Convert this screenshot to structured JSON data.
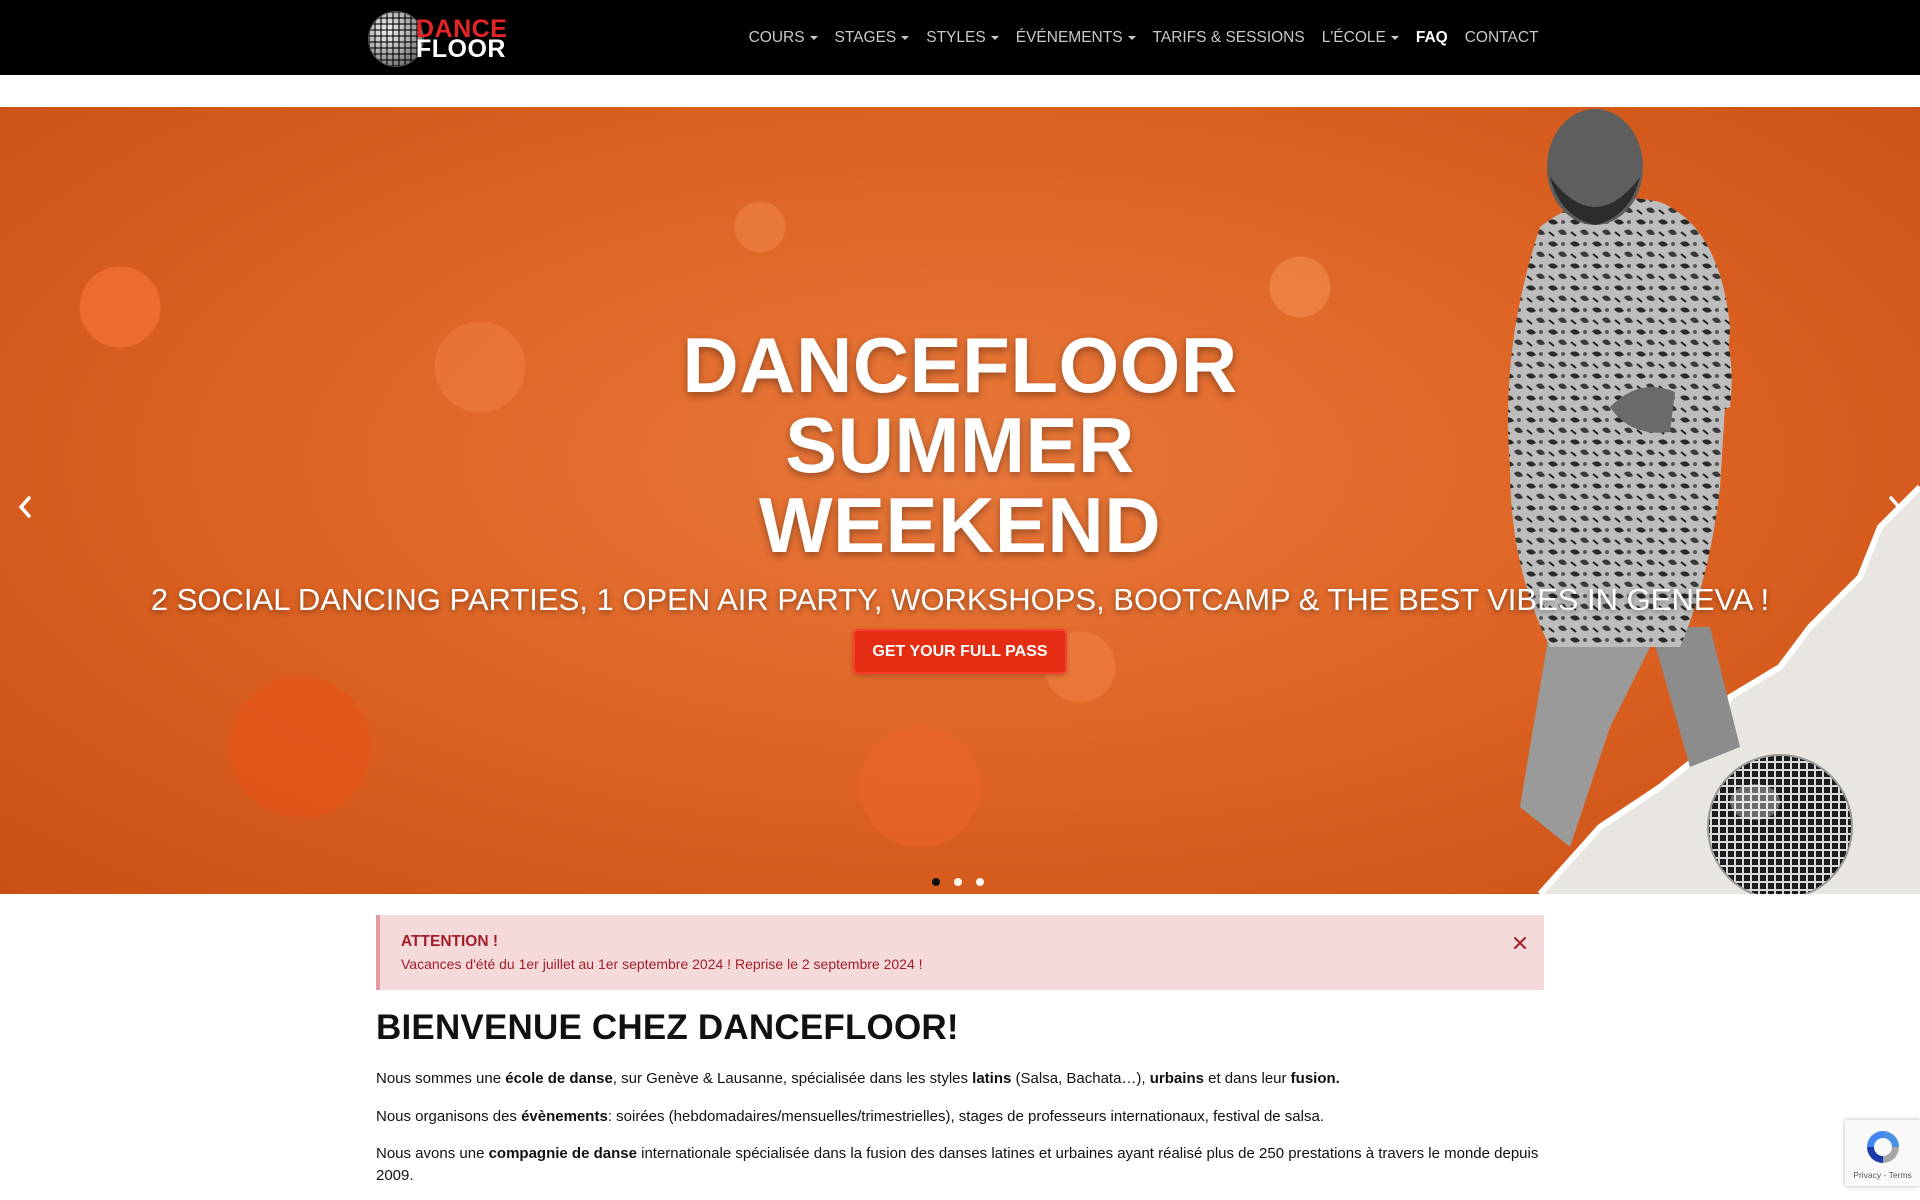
{
  "brand": {
    "line1": "DANCE",
    "line2": "FLOOR",
    "colors": {
      "red": "#e52426",
      "white": "#ffffff",
      "navbar": "#000000"
    }
  },
  "nav": {
    "items": [
      {
        "label": "COURS",
        "dropdown": true
      },
      {
        "label": "STAGES",
        "dropdown": true
      },
      {
        "label": "STYLES",
        "dropdown": true
      },
      {
        "label": "ÉVÉNEMENTS",
        "dropdown": true
      },
      {
        "label": "TARIFS & SESSIONS",
        "dropdown": false
      },
      {
        "label": "L'ÉCOLE",
        "dropdown": true
      },
      {
        "label": "FAQ",
        "dropdown": false,
        "active": true
      },
      {
        "label": "CONTACT",
        "dropdown": false
      }
    ]
  },
  "hero": {
    "title_line1": "DANCEFLOOR",
    "title_line2": "SUMMER",
    "title_line3": "WEEKEND",
    "subtitle": "2 SOCIAL DANCING PARTIES, 1 OPEN AIR PARTY, WORKSHOPS, BOOTCAMP & THE BEST VIBES IN GENEVA !",
    "button_label": "GET YOUR FULL PASS",
    "prev_icon": "chevron-left-icon",
    "next_icon": "chevron-right-icon",
    "slides_count": 3,
    "active_slide": 1,
    "background_color": "#dd6424",
    "button_color": "#e42d12"
  },
  "alert": {
    "title": "ATTENTION !",
    "text": "Vacances d'été du 1er juillet au 1er septembre 2024 ! Reprise le 2 septembre 2024 !",
    "close_icon": "close-icon",
    "color": "#a31e28",
    "background": "#f5dadc"
  },
  "content": {
    "heading": "BIENVENUE CHEZ DANCEFLOOR!",
    "p1": {
      "a": "Nous sommes une ",
      "b": "école de danse",
      "c": ", sur Genève & Lausanne, spécialisée dans les styles ",
      "d": "latins",
      "e": " (Salsa, Bachata…), ",
      "f": "urbains",
      "g": " et dans leur ",
      "h": "fusion."
    },
    "p2": {
      "a": "Nous organisons des ",
      "b": "évènements",
      "c": ": soirées (hebdomadaires/mensuelles/trimestrielles), stages de professeurs internationaux, festival de salsa."
    },
    "p3": {
      "a": "Nous avons une ",
      "b": "compagnie de danse",
      "c": " internationale spécialisée dans la fusion des danses latines et urbaines ayant réalisé plus de 250 prestations à travers le monde depuis 2009."
    }
  },
  "recaptcha": {
    "links": "Privacy - Terms",
    "icon": "recaptcha-icon"
  }
}
